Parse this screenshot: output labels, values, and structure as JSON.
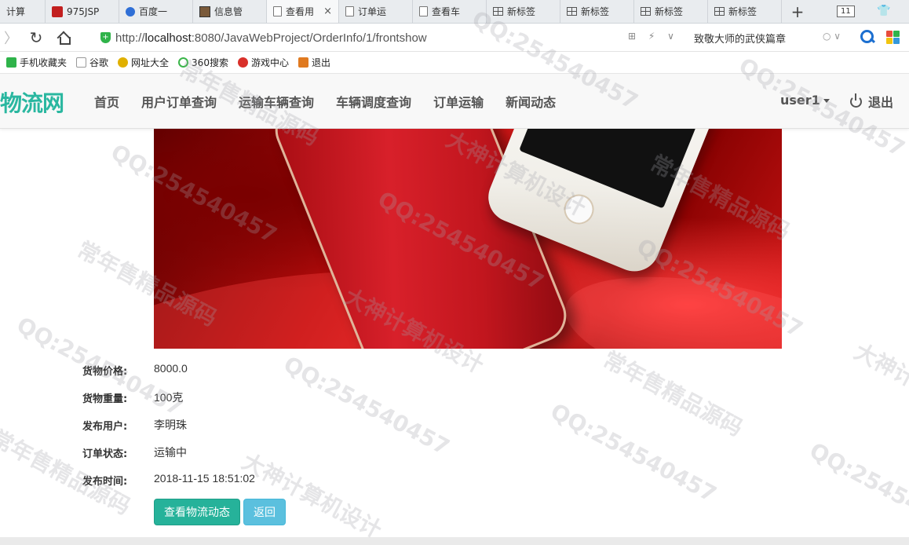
{
  "browser": {
    "tabs": [
      {
        "label": "计算",
        "icon": "none",
        "active": false
      },
      {
        "label": "975JSP",
        "icon": "red-square-icon",
        "active": false
      },
      {
        "label": "百度一",
        "icon": "baidu-paw-icon",
        "active": false
      },
      {
        "label": "信息管",
        "icon": "image-icon",
        "active": false
      },
      {
        "label": "查看用",
        "icon": "page-icon",
        "active": true
      },
      {
        "label": "订单运",
        "icon": "page-icon",
        "active": false
      },
      {
        "label": "查看车",
        "icon": "page-icon",
        "active": false
      },
      {
        "label": "新标签",
        "icon": "grid-icon",
        "active": false
      },
      {
        "label": "新标签",
        "icon": "grid-icon",
        "active": false
      },
      {
        "label": "新标签",
        "icon": "grid-icon",
        "active": false
      },
      {
        "label": "新标签",
        "icon": "grid-icon",
        "active": false
      }
    ],
    "tab_close": "×",
    "new_tab": "+",
    "tab_count": "11",
    "url_scheme": "http://",
    "url_host": "localhost",
    "url_rest": ":8080/JavaWebProject/OrderInfo/1/frontshow",
    "url_tools": "⊞ ⚡ ∨",
    "search_hint": "致敬大师的武侠篇章",
    "search_mini": "○ ∨",
    "bookmarks": [
      {
        "label": "手机收藏夹",
        "color": "#2fb34a"
      },
      {
        "label": "谷歌",
        "color": "#cccccc"
      },
      {
        "label": "网址大全",
        "color": "#e0b000"
      },
      {
        "label": "360搜索",
        "color": "#3bb54a"
      },
      {
        "label": "游戏中心",
        "color": "#d9302a"
      },
      {
        "label": "退出",
        "color": "#e07a20"
      }
    ]
  },
  "site": {
    "brand": "物流网",
    "nav": [
      "首页",
      "用户订单查询",
      "运输车辆查询",
      "车辆调度查询",
      "订单运输",
      "新闻动态"
    ],
    "user": "user1",
    "logout": "退出",
    "accent": "#2ab7a0"
  },
  "order": {
    "rows": [
      {
        "label": "货物价格:",
        "value": "8000.0"
      },
      {
        "label": "货物重量:",
        "value": "100克"
      },
      {
        "label": "发布用户:",
        "value": "李明珠"
      },
      {
        "label": "订单状态:",
        "value": "运输中"
      },
      {
        "label": "发布时间:",
        "value": "2018-11-15 18:51:02"
      }
    ],
    "btn_logistics": "查看物流动态",
    "btn_back": "返回"
  },
  "watermark": {
    "qq": "QQ:254540457",
    "seller": "常年售精品源码",
    "design": "大神计算机设计"
  }
}
